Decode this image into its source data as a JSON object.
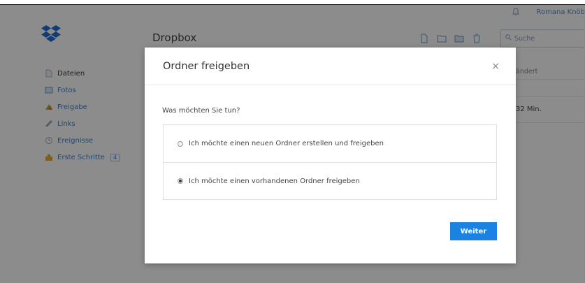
{
  "header": {
    "user_name": "Romana Knöb",
    "app_title": "Dropbox",
    "search_placeholder": "Suche"
  },
  "sidebar": {
    "items": [
      {
        "label": "Dateien",
        "icon": "file-icon"
      },
      {
        "label": "Fotos",
        "icon": "photo-icon"
      },
      {
        "label": "Freigabe",
        "icon": "share-icon"
      },
      {
        "label": "Links",
        "icon": "link-icon"
      },
      {
        "label": "Ereignisse",
        "icon": "events-icon"
      },
      {
        "label": "Erste Schritte",
        "icon": "getting-started-icon",
        "badge": "4"
      }
    ]
  },
  "table": {
    "column_header": "ändert",
    "row_value": "32 Min."
  },
  "modal": {
    "title": "Ordner freigeben",
    "close": "×",
    "question": "Was möchten Sie tun?",
    "options": [
      {
        "label": "Ich möchte einen neuen Ordner erstellen und freigeben",
        "selected": false
      },
      {
        "label": "Ich möchte einen vorhandenen Ordner freigeben",
        "selected": true
      }
    ],
    "continue_label": "Weiter"
  },
  "colors": {
    "accent": "#1a82e2",
    "link": "#3d7fd0"
  }
}
